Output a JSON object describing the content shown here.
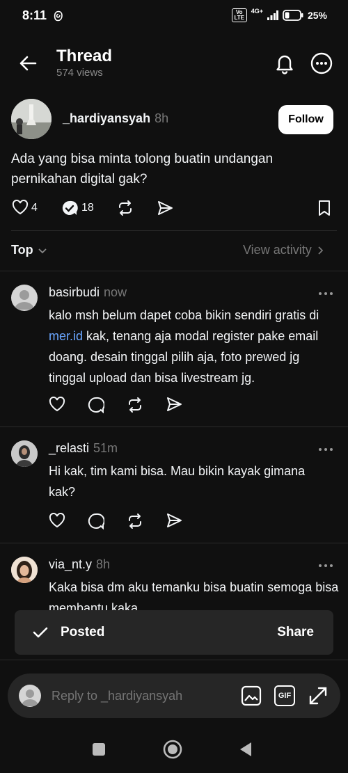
{
  "status_bar": {
    "time": "8:11",
    "network": "4G+",
    "volte": "Vo LTE",
    "battery": "25%"
  },
  "header": {
    "title": "Thread",
    "views": "574 views"
  },
  "post": {
    "username": "_hardiyansyah",
    "time": "8h",
    "follow_label": "Follow",
    "text": "Ada yang bisa minta tolong buatin undangan pernikahan digital gak?",
    "likes": "4",
    "replies": "18"
  },
  "sort": {
    "label": "Top",
    "view_activity": "View activity"
  },
  "replies": [
    {
      "username": "basirbudi",
      "time": "now",
      "text_before_link": "kalo msh belum dapet coba bikin sendiri gratis di ",
      "link": "mer.id",
      "text_after_link": " kak, tenang aja modal register pake email doang. desain tinggal pilih aja, foto prewed jg tinggal upload dan bisa livestream jg."
    },
    {
      "username": "_relasti",
      "time": "51m",
      "text": "Hi kak, tim kami bisa. Mau bikin kayak gimana kak?"
    },
    {
      "username": "via_nt.y",
      "time": "8h",
      "text": "Kaka bisa dm aku temanku bisa buatin semoga bisa membantu kaka"
    }
  ],
  "toast": {
    "message": "Posted",
    "action": "Share"
  },
  "composer": {
    "placeholder": "Reply to _hardiyansyah",
    "gif_label": "GIF"
  },
  "colors": {
    "background": "#101010",
    "link": "#6aa6ff",
    "muted": "#777777"
  }
}
